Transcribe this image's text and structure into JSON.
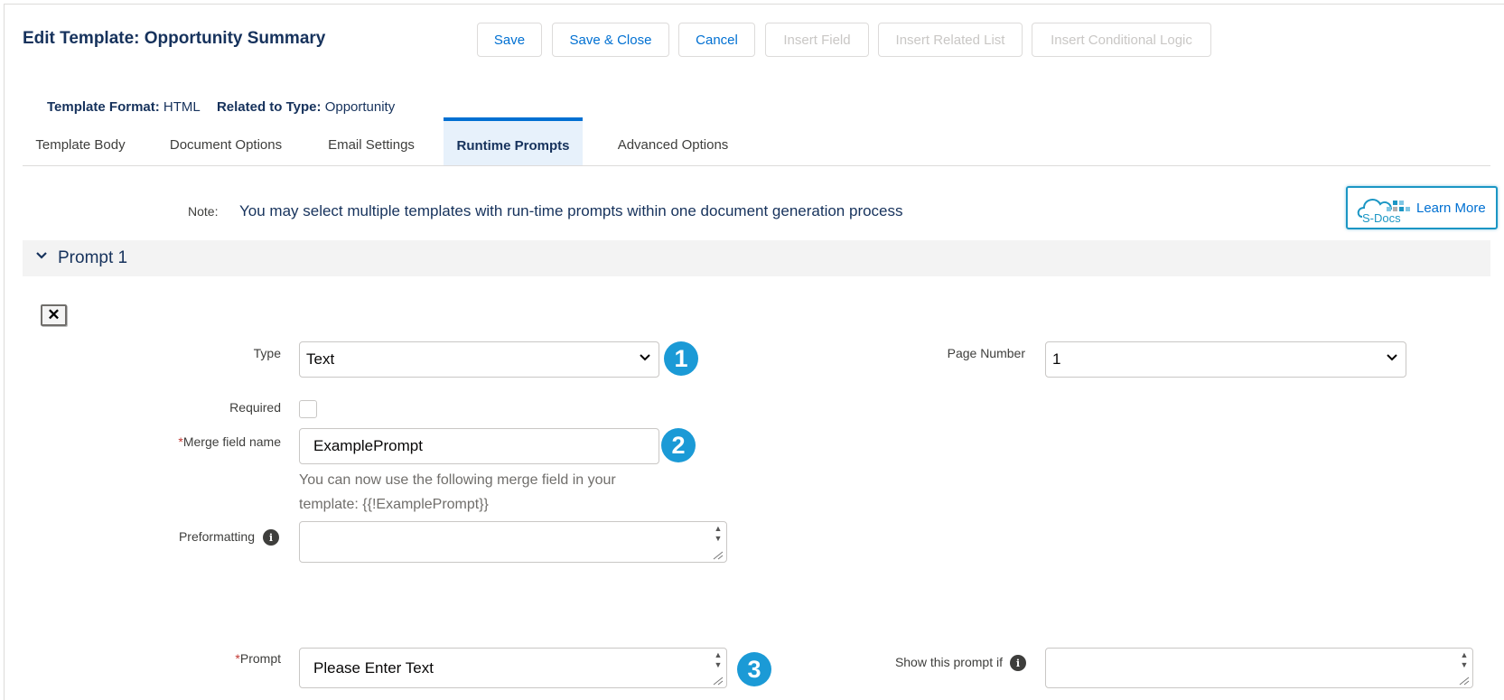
{
  "header": {
    "title": "Edit Template: Opportunity Summary",
    "buttons": {
      "save": "Save",
      "save_close": "Save & Close",
      "cancel": "Cancel",
      "insert_field": "Insert Field",
      "insert_related_list": "Insert Related List",
      "insert_conditional_logic": "Insert Conditional Logic"
    }
  },
  "meta": {
    "format_label": "Template Format:",
    "format_value": "HTML",
    "related_label": "Related to Type:",
    "related_value": "Opportunity"
  },
  "tabs": [
    {
      "label": "Template Body",
      "active": false
    },
    {
      "label": "Document Options",
      "active": false
    },
    {
      "label": "Email Settings",
      "active": false
    },
    {
      "label": "Runtime Prompts",
      "active": true
    },
    {
      "label": "Advanced Options",
      "active": false
    }
  ],
  "note": {
    "label": "Note:",
    "text": "You may select multiple templates with run-time prompts within one document generation process"
  },
  "learn_more": {
    "logo_text": "S-Docs",
    "label": "Learn More"
  },
  "section": {
    "title": "Prompt 1",
    "close_glyph": "✕"
  },
  "form": {
    "type_label": "Type",
    "type_value": "Text",
    "page_number_label": "Page Number",
    "page_number_value": "1",
    "required_label": "Required",
    "required_checked": false,
    "merge_field_label": "Merge field name",
    "merge_field_value": "ExamplePrompt",
    "merge_help": "You can now use the following merge field in your template: {{!ExamplePrompt}}",
    "preformatting_label": "Preformatting",
    "preformatting_value": "",
    "prompt_label": "Prompt",
    "prompt_value": "Please Enter Text",
    "show_if_label": "Show this prompt if",
    "show_if_value": "",
    "required_marker": "*"
  },
  "badges": [
    "1",
    "2",
    "3"
  ],
  "colors": {
    "accent": "#0070d2",
    "badge": "#1b9ad6",
    "heading": "#16325c",
    "required": "#c23934"
  }
}
